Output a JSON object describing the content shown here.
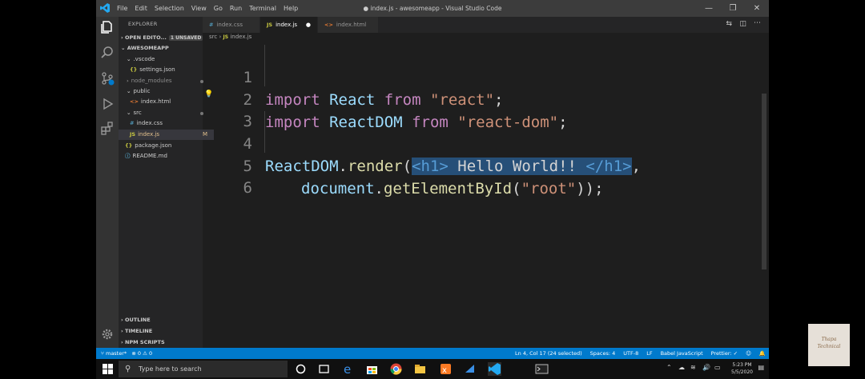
{
  "window": {
    "title": "● index.js - awesomeapp - Visual Studio Code",
    "menu": [
      "File",
      "Edit",
      "Selection",
      "View",
      "Go",
      "Run",
      "Terminal",
      "Help"
    ]
  },
  "sidebar": {
    "title": "EXPLORER",
    "open_editors": "OPEN EDITO...",
    "open_editors_badge": "1 UNSAVED",
    "project": "AWESOMEAPP",
    "tree": [
      {
        "label": ".vscode",
        "icon": "⌄"
      },
      {
        "label": "settings.json",
        "icon": "{}"
      },
      {
        "label": "node_modules",
        "icon": "›"
      },
      {
        "label": "public",
        "icon": "⌄"
      },
      {
        "label": "index.html",
        "icon": "<>"
      },
      {
        "label": "src",
        "icon": "⌄"
      },
      {
        "label": "index.css",
        "icon": "#"
      },
      {
        "label": "index.js",
        "icon": "JS",
        "mark": "M"
      },
      {
        "label": "package.json",
        "icon": "{}"
      },
      {
        "label": "README.md",
        "icon": "ⓘ"
      }
    ],
    "outline": "OUTLINE",
    "timeline": "TIMELINE",
    "npm_scripts": "NPM SCRIPTS"
  },
  "tabs": [
    {
      "label": "index.css",
      "icon": "#"
    },
    {
      "label": "index.js",
      "icon": "JS"
    },
    {
      "label": "index.html",
      "icon": "<>"
    }
  ],
  "breadcrumb": {
    "folder": "src",
    "sep": "›",
    "file": "index.js",
    "icon": "JS"
  },
  "code": {
    "line_numbers": [
      "1",
      "2",
      "3",
      "4",
      "5",
      "6"
    ],
    "l1": {
      "kw1": "import",
      "id": "React",
      "kw2": "from",
      "str": "\"react\"",
      "end": ";"
    },
    "l2": {
      "kw1": "import",
      "id": "ReactDOM",
      "kw2": "from",
      "str": "\"react-dom\"",
      "end": ";"
    },
    "l4": {
      "obj": "ReactDOM",
      "dot": ".",
      "fn": "render",
      "open": "(",
      "tag_open": "<h1>",
      "text": " Hello World!! ",
      "tag_close": "</h1>",
      "end": ","
    },
    "l5": {
      "obj": "document",
      "dot": ".",
      "fn": "getElementById",
      "open": "(",
      "str": "\"root\"",
      "end": "));"
    }
  },
  "statusbar": {
    "branch": "master*",
    "problems": "⊗ 0 ⚠ 0",
    "position": "Ln 4, Col 17 (24 selected)",
    "spaces": "Spaces: 4",
    "encoding": "UTF-8",
    "eol": "LF",
    "language": "Babel JavaScript",
    "prettier": "Prettier: ✓"
  },
  "taskbar": {
    "search_placeholder": "Type here to search",
    "time": "5:23 PM",
    "date": "5/5/2020"
  },
  "watermark": {
    "line1": "Thapa",
    "line2": "Technical"
  },
  "colors": {
    "statusbar": "#007acc",
    "editor": "#1e1e1e",
    "sidebar": "#252526",
    "activity": "#333333"
  }
}
